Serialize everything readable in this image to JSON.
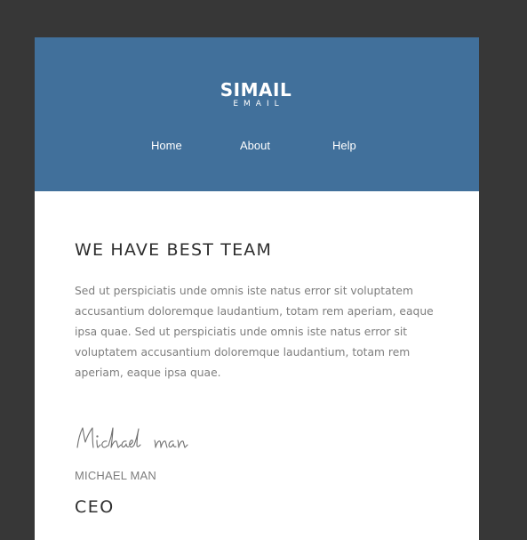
{
  "header": {
    "logo_main": "SIMAIL",
    "logo_sub": "EMAIL",
    "nav": [
      {
        "label": "Home"
      },
      {
        "label": "About"
      },
      {
        "label": "Help"
      }
    ]
  },
  "content": {
    "heading": "WE HAVE BEST TEAM",
    "body": "Sed ut perspiciatis unde omnis iste natus error sit voluptatem accusantium doloremque laudantium, totam rem aperiam, eaque ipsa quae. Sed ut perspiciatis unde omnis iste natus error sit voluptatem accusantium doloremque laudantium, totam rem aperiam, eaque ipsa quae.",
    "signature": "Michael man",
    "signer_name": "MICHAEL MAN",
    "signer_title": "CEO"
  },
  "colors": {
    "background": "#373737",
    "header": "#41709b",
    "card": "#ffffff",
    "heading_text": "#2e2e2e",
    "body_text": "#7d7d7d"
  }
}
